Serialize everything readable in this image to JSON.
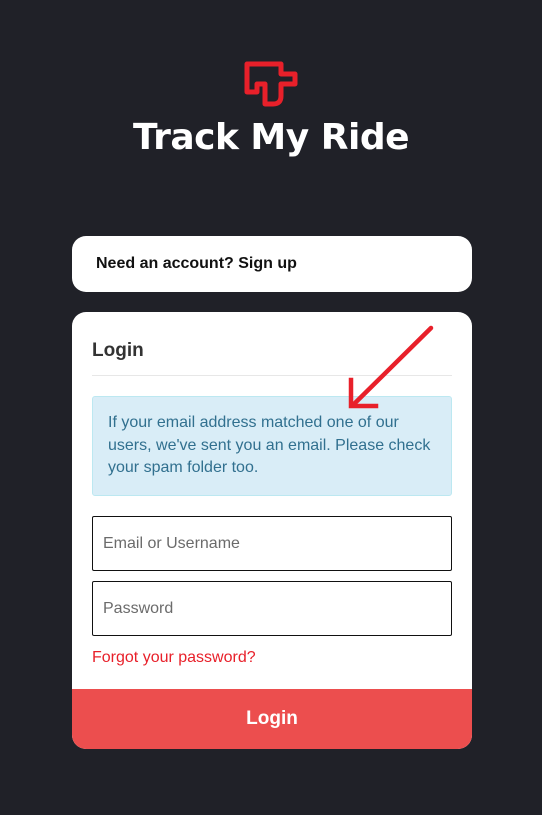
{
  "brand": {
    "name": "Track My Ride",
    "logo_icon": "track-my-ride-logo-icon",
    "accent_color": "#e8202a"
  },
  "signup": {
    "text": "Need an account? Sign up"
  },
  "login": {
    "heading": "Login",
    "alert_text": "If your email address matched one of our users, we've sent you an email. Please check your spam folder too.",
    "email_placeholder": "Email or Username",
    "password_placeholder": "Password",
    "forgot_label": "Forgot your password?",
    "button_label": "Login",
    "button_color": "#ec4e4e"
  },
  "annotation": {
    "icon": "red-arrow-icon",
    "color": "#e8202a"
  }
}
